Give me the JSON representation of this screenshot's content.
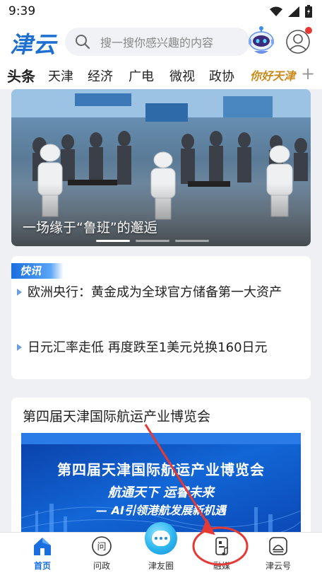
{
  "status_bar": {
    "time": "9:39"
  },
  "header": {
    "logo_text": "津云",
    "search_placeholder": "搜一搜你感兴趣的内容"
  },
  "tabs": [
    {
      "label": "头条",
      "active": true
    },
    {
      "label": "天津"
    },
    {
      "label": "经济"
    },
    {
      "label": "广电"
    },
    {
      "label": "微视"
    },
    {
      "label": "政协"
    },
    {
      "label": "你好天津"
    }
  ],
  "hero": {
    "caption": "一场缘于“鲁班”的邂逅"
  },
  "flash": {
    "badge": "快讯",
    "items": [
      "欧洲央行：黄金成为全球官方储备第一大资产",
      "日元汇率走低 再度跌至1美元兑换160日元"
    ]
  },
  "article": {
    "title": "第四届天津国际航运产业博览会",
    "banner_title": "第四届天津国际航运产业博览会",
    "banner_slogan": "航通天下 运睿未来",
    "banner_subtitle": "— AI引领港航发展新机遇"
  },
  "bottom_nav": [
    {
      "label": "首页",
      "icon": "home-icon",
      "active": true
    },
    {
      "label": "问政",
      "icon": "inquiry-icon"
    },
    {
      "label": "津友圈",
      "icon": "chat-icon"
    },
    {
      "label": "融媒",
      "icon": "media-icon"
    },
    {
      "label": "津云号",
      "icon": "account-icon"
    }
  ],
  "colors": {
    "brand": "#1e6fd0",
    "accent_red": "#e53935",
    "nav_active": "#1a6ee0"
  }
}
